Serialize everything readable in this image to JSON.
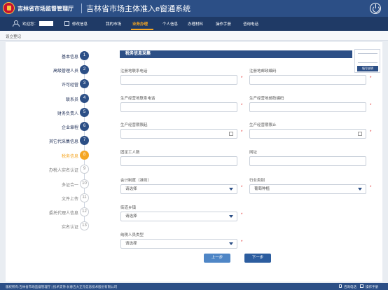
{
  "header": {
    "org_name": "吉林省市场监督管理厅",
    "system_title": "吉林省市场主体准入e窗通系统"
  },
  "nav": {
    "welcome": "欢迎您：",
    "edit_info": "修改信息",
    "items": [
      "我的市场",
      "业务办理",
      "个人信息",
      "办理材料",
      "操作手册",
      "咨询电话"
    ],
    "active": "业务办理"
  },
  "breadcrumb": "设立登记",
  "steps": [
    {
      "label": "基本信息",
      "num": "1",
      "status": "done"
    },
    {
      "label": "高级管理人员",
      "num": "2",
      "status": "done"
    },
    {
      "label": "许可经营",
      "num": "3",
      "status": "done"
    },
    {
      "label": "联系员",
      "num": "4",
      "status": "done"
    },
    {
      "label": "财务负责人",
      "num": "5",
      "status": "done"
    },
    {
      "label": "企业章程",
      "num": "6",
      "status": "done"
    },
    {
      "label": "其它代采集信息",
      "num": "7",
      "status": "done"
    },
    {
      "label": "税务信息",
      "num": "8",
      "status": "active"
    },
    {
      "label": "办税人实名认证",
      "num": "9",
      "status": "pending"
    },
    {
      "label": "多证合一",
      "num": "10",
      "status": "pending"
    },
    {
      "label": "文件上传",
      "num": "11",
      "status": "pending"
    },
    {
      "label": "委托代理人信息",
      "num": "12",
      "status": "pending"
    },
    {
      "label": "实名认证",
      "num": "13",
      "status": "pending"
    }
  ],
  "section_title": "税务信息采集",
  "thumbnail_label": "填写说明",
  "form": {
    "reg_phone_label": "注册地联系电话",
    "reg_postcode_label": "注册地邮政编码",
    "biz_phone_label": "生产经营地联系电话",
    "biz_postcode_label": "生产经营地邮政编码",
    "biz_start_label": "生产经营期限起",
    "biz_end_label": "生产经营期限止",
    "employees_label": "固定工人数",
    "website_label": "网址",
    "accounting_label": "会计制度（准则）",
    "accounting_value": "请选择",
    "industry_label": "行业类别",
    "industry_value": "葡萄种植",
    "street_label": "街道乡镇",
    "street_value": "请选择",
    "taxpayer_type_label": "纳税人员类型",
    "taxpayer_type_value": "请选择",
    "required_mark": "*"
  },
  "buttons": {
    "prev": "上一步",
    "next": "下一步"
  },
  "footer": {
    "text": "版权所有:吉林省市场监督管理厅 | 技术支持:长春吉大正元信息技术股份有限公司",
    "hotline": "咨询电话",
    "manual": "操作手册"
  }
}
